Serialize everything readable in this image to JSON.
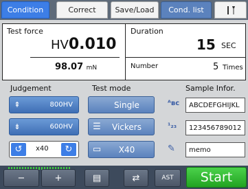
{
  "tabs": [
    {
      "label": "Condition",
      "active": true
    },
    {
      "label": "Correct"
    },
    {
      "label": "Save/Load"
    },
    {
      "label": "Cond. list"
    },
    {
      "icon": "tools-icon"
    }
  ],
  "display": {
    "test_force_label": "Test force",
    "hardness_prefix": "HV",
    "hardness_value": "0.010",
    "force_value": "98.07",
    "force_unit": "mN",
    "duration_label": "Duration",
    "duration_value": "15",
    "duration_unit": "SEC",
    "number_label": "Number",
    "number_value": "5",
    "number_unit": "Times"
  },
  "judgement": {
    "label": "Judgement",
    "upper": "800HV",
    "lower": "600HV",
    "magnification": "x40"
  },
  "test_mode": {
    "label": "Test mode",
    "mode": "Single",
    "indenter": "Vickers",
    "objective": "X40"
  },
  "sample": {
    "label": "Sample Infor.",
    "name": "ABCDEFGHIJKL",
    "number": "123456789012",
    "memo": "memo"
  },
  "bottom": {
    "minus": "−",
    "plus": "+",
    "ast_label": "AST",
    "start_label": "Start"
  },
  "colors": {
    "accent": "#3d7ee6",
    "start": "#2fbf2f",
    "bar": "#3d4a5c"
  }
}
